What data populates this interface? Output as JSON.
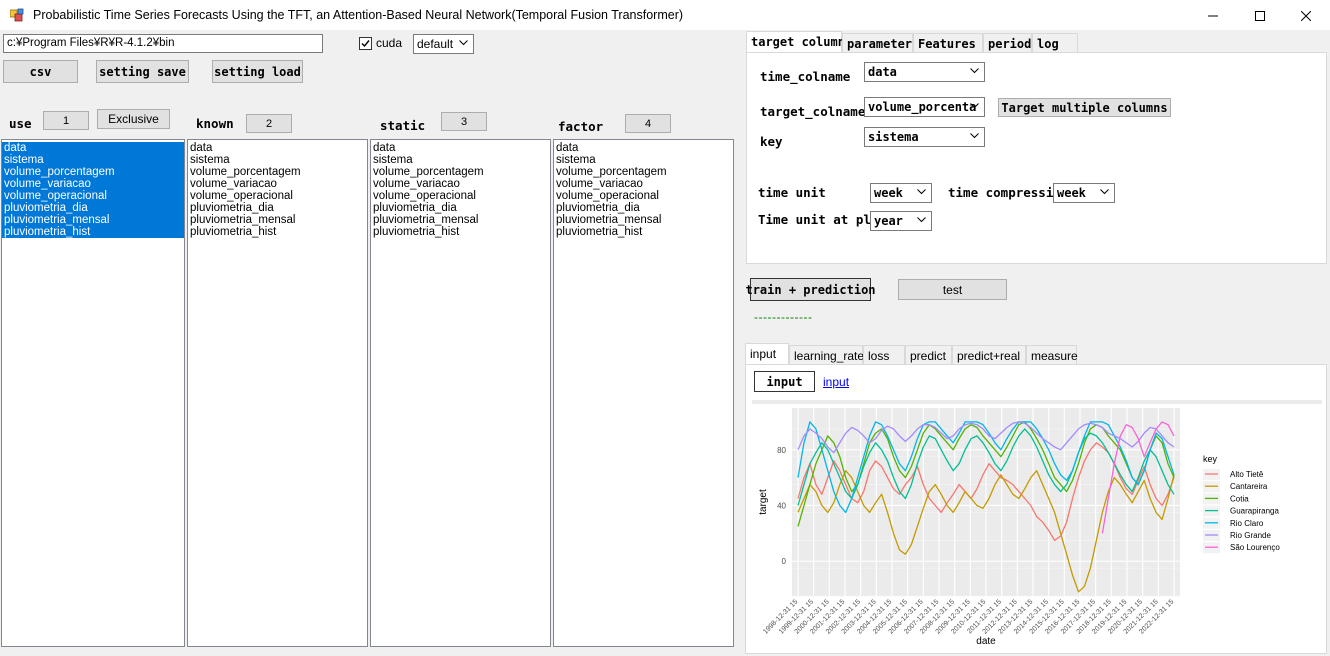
{
  "window": {
    "title": "Probabilistic Time Series Forecasts Using the TFT, an Attention-Based Neural Network(Temporal Fusion Transformer)"
  },
  "toolbar": {
    "r_path": "c:¥Program Files¥R¥R-4.1.2¥bin",
    "cuda_label": "cuda",
    "cuda_checked": true,
    "device_value": "default",
    "csv_label": "csv",
    "setting_save_label": "setting save",
    "setting_load_label": "setting load"
  },
  "columns": {
    "use": {
      "label": "use",
      "count": "1",
      "exclusive_label": "Exclusive"
    },
    "known": {
      "label": "known",
      "count": "2"
    },
    "static": {
      "label": "static",
      "count": "3"
    },
    "factor": {
      "label": "factor",
      "count": "4"
    },
    "items": [
      "data",
      "sistema",
      "volume_porcentagem",
      "volume_variacao",
      "volume_operacional",
      "pluviometria_dia",
      "pluviometria_mensal",
      "pluviometria_hist"
    ]
  },
  "settings_tabs": [
    "target column",
    "parameter",
    "Features",
    "period",
    "log"
  ],
  "target": {
    "time_colname_label": "time_colname",
    "time_colname_value": "data",
    "target_colname_label": "target_colname",
    "target_colname_value": "volume_porcenta",
    "target_multiple_label": "Target multiple columns",
    "key_label": "key",
    "key_value": "sistema",
    "time_unit_label": "time unit",
    "time_unit_value": "week",
    "time_compression_label": "time compression",
    "time_compression_value": "week",
    "time_unit_plot_label": "Time unit at plot",
    "time_unit_plot_value": "year"
  },
  "actions": {
    "train_label": "train + prediction",
    "test_label": "test",
    "progress_text": "-------------"
  },
  "result_tabs": [
    "input",
    "learning_rate",
    "loss",
    "predict",
    "predict+real",
    "measure"
  ],
  "input_panel": {
    "button_label": "input",
    "link_label": "input"
  },
  "chart_data": {
    "type": "line",
    "xlabel": "date",
    "ylabel": "target",
    "y_ticks": [
      0,
      40,
      80
    ],
    "ylim": [
      -25,
      110
    ],
    "x_ticks": [
      "1998-12-31 15",
      "1999-12-31 15",
      "2000-12-31 15",
      "2001-12-31 15",
      "2002-12-31 15",
      "2003-12-31 15",
      "2004-12-31 15",
      "2005-12-31 15",
      "2006-12-31 15",
      "2007-12-31 15",
      "2008-12-31 15",
      "2009-12-31 15",
      "2010-12-31 15",
      "2011-12-31 15",
      "2012-12-31 15",
      "2013-12-31 15",
      "2014-12-31 15",
      "2015-12-31 15",
      "2016-12-31 15",
      "2017-12-31 15",
      "2018-12-31 15",
      "2019-12-31 15",
      "2020-12-31 15",
      "2021-12-31 15",
      "2022-12-31 15"
    ],
    "legend_title": "key",
    "legend_position": "right",
    "series": [
      {
        "name": "Alto Tietê",
        "color": "#f8766d",
        "values": [
          45,
          60,
          70,
          55,
          48,
          60,
          72,
          65,
          55,
          45,
          42,
          50,
          65,
          72,
          68,
          60,
          52,
          48,
          55,
          60,
          68,
          55,
          45,
          40,
          35,
          42,
          48,
          55,
          50,
          45,
          52,
          62,
          70,
          65,
          60,
          58,
          55,
          50,
          45,
          40,
          32,
          28,
          22,
          15,
          18,
          28,
          45,
          60,
          72,
          80,
          85,
          82,
          78,
          70,
          60,
          52,
          48,
          58,
          68,
          55,
          45,
          40,
          48,
          60
        ]
      },
      {
        "name": "Cantareira",
        "color": "#c49a00",
        "values": [
          35,
          45,
          55,
          50,
          40,
          35,
          42,
          55,
          65,
          60,
          50,
          40,
          35,
          42,
          48,
          35,
          20,
          8,
          5,
          12,
          25,
          38,
          50,
          55,
          48,
          40,
          35,
          42,
          50,
          45,
          40,
          38,
          45,
          55,
          62,
          55,
          48,
          45,
          52,
          60,
          65,
          55,
          45,
          35,
          20,
          5,
          -10,
          -22,
          -18,
          -5,
          15,
          35,
          50,
          60,
          55,
          48,
          42,
          50,
          58,
          45,
          35,
          30,
          45,
          62
        ]
      },
      {
        "name": "Cotia",
        "color": "#53b400",
        "values": [
          25,
          40,
          55,
          70,
          80,
          90,
          85,
          75,
          60,
          50,
          55,
          70,
          85,
          92,
          95,
          88,
          75,
          65,
          60,
          68,
          80,
          92,
          98,
          95,
          90,
          85,
          80,
          88,
          95,
          98,
          96,
          90,
          85,
          80,
          75,
          82,
          90,
          98,
          100,
          95,
          88,
          80,
          70,
          60,
          55,
          50,
          58,
          70,
          85,
          95,
          98,
          96,
          90,
          85,
          80,
          70,
          60,
          55,
          65,
          80,
          90,
          85,
          70,
          60
        ]
      },
      {
        "name": "Guarapiranga",
        "color": "#00c094",
        "values": [
          40,
          55,
          70,
          78,
          85,
          80,
          70,
          60,
          50,
          45,
          55,
          68,
          78,
          85,
          80,
          72,
          60,
          50,
          45,
          55,
          70,
          82,
          90,
          88,
          80,
          72,
          65,
          70,
          80,
          88,
          90,
          85,
          78,
          70,
          65,
          72,
          82,
          90,
          95,
          90,
          82,
          72,
          62,
          55,
          50,
          55,
          65,
          78,
          88,
          92,
          90,
          85,
          78,
          70,
          62,
          55,
          50,
          60,
          72,
          80,
          75,
          65,
          55,
          48
        ]
      },
      {
        "name": "Rio Claro",
        "color": "#00b6eb",
        "values": [
          60,
          85,
          100,
          95,
          80,
          65,
          50,
          40,
          35,
          45,
          60,
          75,
          90,
          100,
          98,
          90,
          80,
          70,
          65,
          75,
          88,
          98,
          100,
          100,
          95,
          90,
          85,
          92,
          100,
          100,
          100,
          98,
          92,
          85,
          80,
          88,
          95,
          100,
          100,
          100,
          95,
          88,
          80,
          70,
          62,
          58,
          65,
          78,
          90,
          100,
          100,
          100,
          98,
          90,
          82,
          72,
          60,
          55,
          65,
          80,
          92,
          88,
          75,
          62
        ]
      },
      {
        "name": "Rio Grande",
        "color": "#a58aff",
        "values": [
          80,
          90,
          95,
          92,
          88,
          82,
          78,
          85,
          92,
          96,
          94,
          90,
          85,
          88,
          94,
          97,
          95,
          90,
          86,
          90,
          95,
          98,
          98,
          96,
          92,
          88,
          90,
          95,
          98,
          99,
          98,
          95,
          90,
          88,
          92,
          96,
          99,
          100,
          99,
          96,
          92,
          88,
          85,
          82,
          80,
          85,
          90,
          95,
          98,
          99,
          98,
          96,
          92,
          90,
          88,
          85,
          82,
          86,
          92,
          96,
          95,
          90,
          85,
          82
        ]
      },
      {
        "name": "São Lourenço",
        "color": "#fb61d7",
        "values": [
          null,
          null,
          null,
          null,
          null,
          null,
          null,
          null,
          null,
          null,
          null,
          null,
          null,
          null,
          null,
          null,
          null,
          null,
          null,
          null,
          null,
          null,
          null,
          null,
          null,
          null,
          null,
          null,
          null,
          null,
          null,
          null,
          null,
          null,
          null,
          null,
          null,
          null,
          null,
          null,
          null,
          null,
          null,
          null,
          null,
          null,
          null,
          null,
          null,
          null,
          null,
          20,
          45,
          70,
          90,
          98,
          96,
          88,
          75,
          85,
          95,
          100,
          98,
          90
        ]
      }
    ]
  }
}
